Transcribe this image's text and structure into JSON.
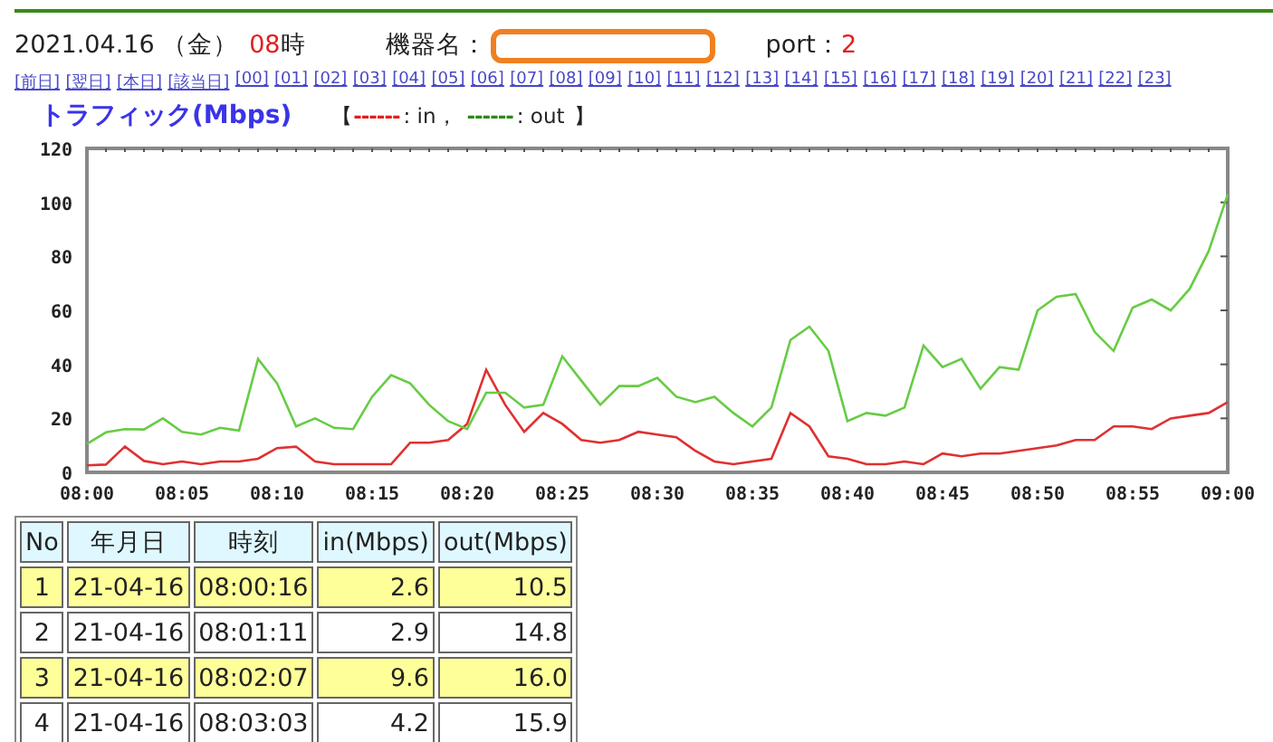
{
  "header": {
    "date": "2021.04.16 （金）",
    "hour": "08",
    "hour_suffix": "時",
    "device_label": "機器名：",
    "port_label": "port：",
    "port": "2"
  },
  "nav_links": [
    "[前日]",
    "[翌日]",
    "[本日]",
    "[該当日]",
    "[00]",
    "[01]",
    "[02]",
    "[03]",
    "[04]",
    "[05]",
    "[06]",
    "[07]",
    "[08]",
    "[09]",
    "[10]",
    "[11]",
    "[12]",
    "[13]",
    "[14]",
    "[15]",
    "[16]",
    "[17]",
    "[18]",
    "[19]",
    "[20]",
    "[21]",
    "[22]",
    "[23]"
  ],
  "graph_title": "トラフィック(Mbps)",
  "legend": {
    "open": "【",
    "close": "】",
    "entries": [
      {
        "dash": "------",
        "label": ": in，",
        "color": "#e02020"
      },
      {
        "dash": "------",
        "label": ": out",
        "color": "#2a8a1a"
      }
    ]
  },
  "chart_data": {
    "type": "line",
    "categories": [
      "08:00",
      null,
      null,
      null,
      null,
      "08:05",
      null,
      null,
      null,
      null,
      "08:10",
      null,
      null,
      null,
      null,
      "08:15",
      null,
      null,
      null,
      null,
      "08:20",
      null,
      null,
      null,
      null,
      "08:25",
      null,
      null,
      null,
      null,
      "08:30",
      null,
      null,
      null,
      null,
      "08:35",
      null,
      null,
      null,
      null,
      "08:40",
      null,
      null,
      null,
      null,
      "08:45",
      null,
      null,
      null,
      null,
      "08:50",
      null,
      null,
      null,
      null,
      "08:55",
      null,
      null,
      null,
      null,
      "09:00"
    ],
    "series": [
      {
        "color": "#e03030",
        "values": [
          2.6,
          2.9,
          9.6,
          4.2,
          3,
          4,
          3,
          4,
          4,
          5,
          9,
          9.5,
          4,
          3,
          3,
          3,
          3,
          11,
          11,
          12,
          18,
          38,
          25,
          15,
          22,
          18,
          12,
          11,
          12,
          15,
          14,
          13,
          8,
          4,
          3,
          4,
          5,
          22,
          17,
          6,
          5,
          3,
          3,
          4,
          3,
          7,
          6,
          7,
          7,
          8,
          9,
          10,
          12,
          12,
          17,
          17,
          16,
          20,
          21,
          22,
          26
        ]
      },
      {
        "color": "#66cc44",
        "values": [
          10.5,
          14.8,
          16,
          15.9,
          20,
          15,
          14,
          16.5,
          15.5,
          42,
          33,
          17,
          20,
          16.5,
          16,
          28,
          36,
          33,
          25,
          19,
          16,
          29.5,
          29.5,
          24,
          25,
          43,
          34,
          25,
          32,
          32,
          35,
          28,
          26,
          28,
          22,
          17,
          24,
          49,
          54,
          45,
          19,
          22,
          21,
          24,
          47,
          39,
          42,
          31,
          39,
          38,
          60,
          65,
          66,
          52,
          45,
          61,
          64,
          60,
          68,
          82,
          103
        ]
      }
    ],
    "ylim": [
      0,
      120
    ],
    "yticks": [
      0,
      20,
      40,
      60,
      80,
      100,
      120
    ]
  },
  "table": {
    "columns": [
      "No",
      "年月日",
      "時刻",
      "in(Mbps)",
      "out(Mbps)"
    ],
    "rows": [
      [
        "1",
        "21-04-16",
        "08:00:16",
        "2.6",
        "10.5"
      ],
      [
        "2",
        "21-04-16",
        "08:01:11",
        "2.9",
        "14.8"
      ],
      [
        "3",
        "21-04-16",
        "08:02:07",
        "9.6",
        "16.0"
      ],
      [
        "4",
        "21-04-16",
        "08:03:03",
        "4.2",
        "15.9"
      ]
    ]
  }
}
